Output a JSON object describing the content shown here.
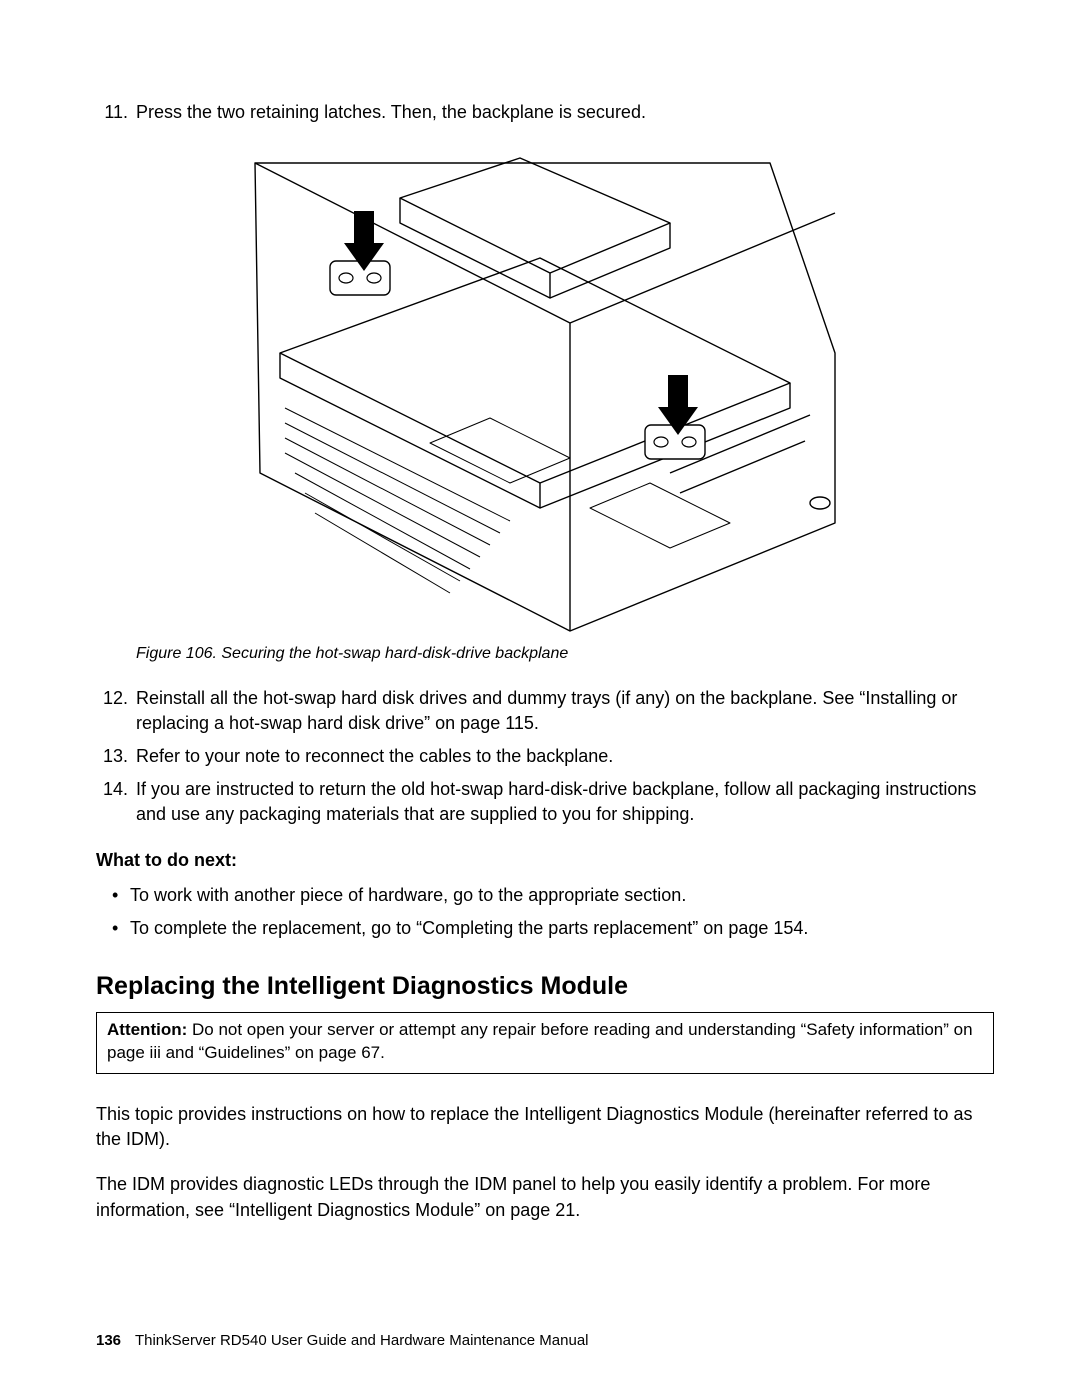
{
  "steps": {
    "s11": {
      "num": "11.",
      "text": "Press the two retaining latches. Then, the backplane is secured."
    },
    "s12": {
      "num": "12.",
      "text": "Reinstall all the hot-swap hard disk drives and dummy trays (if any) on the backplane. See “Installing or replacing a hot-swap hard disk drive” on page 115."
    },
    "s13": {
      "num": "13.",
      "text": "Refer to your note to reconnect the cables to the backplane."
    },
    "s14": {
      "num": "14.",
      "text": "If you are instructed to return the old hot-swap hard-disk-drive backplane, follow all packaging instructions and use any packaging materials that are supplied to you for shipping."
    }
  },
  "figure": {
    "caption": "Figure 106. Securing the hot-swap hard-disk-drive backplane"
  },
  "what_next": {
    "heading": "What to do next:",
    "b1": "To work with another piece of hardware, go to the appropriate section.",
    "b2": "To complete the replacement, go to “Completing the parts replacement” on page 154."
  },
  "section": {
    "heading": "Replacing the Intelligent Diagnostics Module",
    "attention_label": "Attention:",
    "attention_text": " Do not open your server or attempt any repair before reading and understanding “Safety information” on page iii and “Guidelines” on page 67.",
    "para1": "This topic provides instructions on how to replace the Intelligent Diagnostics Module (hereinafter referred to as the IDM).",
    "para2": "The IDM provides diagnostic LEDs through the IDM panel to help you easily identify a problem. For more information, see “Intelligent Diagnostics Module” on page 21."
  },
  "footer": {
    "page": "136",
    "title": "ThinkServer RD540 User Guide and Hardware Maintenance Manual"
  }
}
